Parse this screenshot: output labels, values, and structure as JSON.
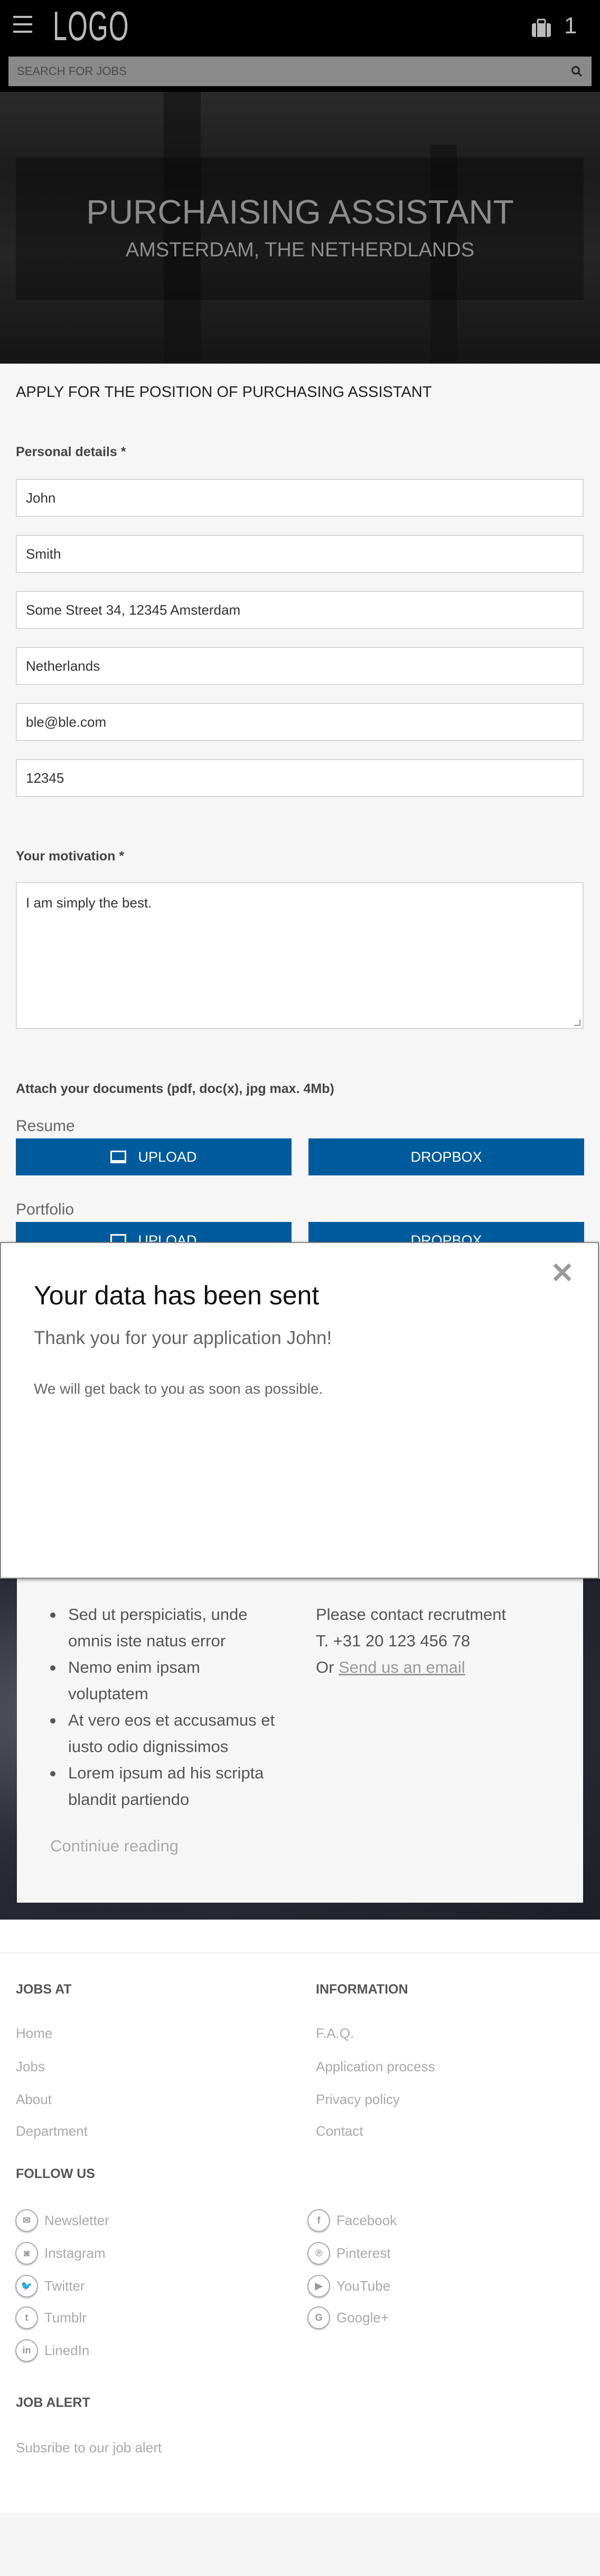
{
  "header": {
    "logo": "LOGO",
    "cart_count": "1",
    "search_placeholder": "SEARCH FOR JOBS"
  },
  "hero": {
    "title": "PURCHAISING ASSISTANT",
    "subtitle": "AMSTERDAM, THE NETHERDLANDS"
  },
  "form": {
    "heading": "APPLY FOR THE POSITION OF PURCHASING ASSISTANT",
    "personal_label": "Personal details *",
    "fields": [
      "John",
      "Smith",
      "Some Street 34, 12345 Amsterdam",
      "Netherlands",
      "ble@ble.com",
      "12345"
    ],
    "motivation_label": "Your motivation *",
    "motivation": "I am simply the best.",
    "attach_label": "Attach your documents (pdf, doc(x), jpg max. 4Mb)",
    "resume_label": "Resume",
    "portfolio_label": "Portfolio",
    "upload": "UPLOAD",
    "dropbox": "DROPBOX"
  },
  "details": {
    "bullets": [
      "Sed ut perspiciatis, unde omnis iste natus error",
      "Nemo enim ipsam voluptatem",
      "At vero eos et accusamus et iusto odio dignissimos",
      "Lorem ipsum ad his scripta blandit partiendo"
    ],
    "contact_line": "Please contact recrutment",
    "phone": "T. +31 20 123 456 78",
    "or": "Or",
    "email_link": "Send us an email",
    "continue": "Continiue reading"
  },
  "modal": {
    "title": "Your data has been sent",
    "thanks": "Thank you for your application John!",
    "message": "We will get back to you as soon as possible.",
    "close": "✕"
  },
  "footer": {
    "jobs_heading": "JOBS AT",
    "jobs_links": [
      "Home",
      "Jobs",
      "About",
      "Department"
    ],
    "info_heading": "INFORMATION",
    "info_links": [
      "F.A.Q.",
      "Application process",
      "Privacy policy",
      "Contact"
    ],
    "follow_heading": "FOLLOW US",
    "social_left": [
      {
        "label": "Newsletter",
        "icon": "✉"
      },
      {
        "label": "Instagram",
        "icon": "◙"
      },
      {
        "label": "Twitter",
        "icon": "🐦"
      },
      {
        "label": "Tumblr",
        "icon": "t"
      },
      {
        "label": "LinedIn",
        "icon": "in"
      }
    ],
    "social_right": [
      {
        "label": "Facebook",
        "icon": "f"
      },
      {
        "label": "Pinterest",
        "icon": "℗"
      },
      {
        "label": "YouTube",
        "icon": "▶"
      },
      {
        "label": "Google+",
        "icon": "G"
      }
    ],
    "alert_heading": "JOB ALERT",
    "alert_link": "Subsribe to our job alert"
  },
  "colors": {
    "brand_blue": "#005b9d",
    "header_bg": "#000000"
  }
}
